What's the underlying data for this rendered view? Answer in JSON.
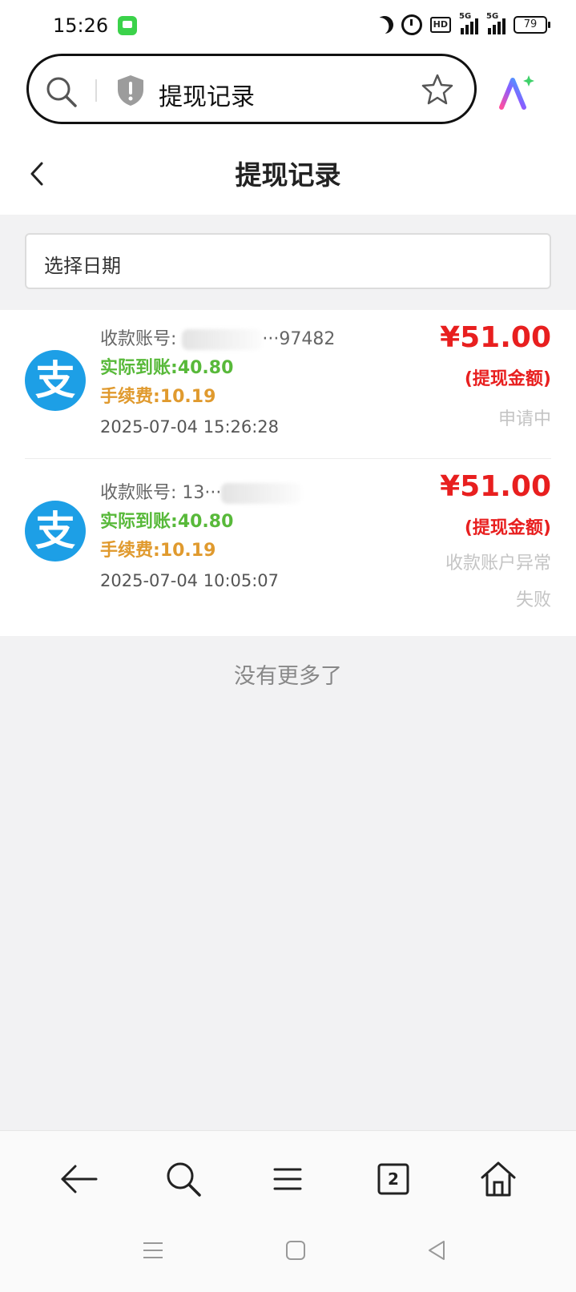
{
  "status_bar": {
    "time": "15:26",
    "hd_label": "HD",
    "sig1_label": "5G",
    "sig2_label": "5G",
    "battery": "79"
  },
  "browser": {
    "url_text": "提现记录"
  },
  "page": {
    "title": "提现记录",
    "date_placeholder": "选择日期",
    "no_more": "没有更多了"
  },
  "records": [
    {
      "account_label": "收款账号:",
      "account_value": "···97482",
      "actual_label": "实际到账:",
      "actual_value": "40.80",
      "fee_label": "手续费:",
      "fee_value": "10.19",
      "datetime": "2025-07-04 15:26:28",
      "amount": "¥51.00",
      "amount_label": "(提现金额)",
      "status": "申请中"
    },
    {
      "account_label": "收款账号:",
      "account_value": "13···",
      "actual_label": "实际到账:",
      "actual_value": "40.80",
      "fee_label": "手续费:",
      "fee_value": "10.19",
      "datetime": "2025-07-04 10:05:07",
      "amount": "¥51.00",
      "amount_label": "(提现金额)",
      "status": "收款账户异常",
      "status2": "失败"
    }
  ],
  "toolbar": {
    "tab_count": "2"
  },
  "avatar_glyph": "支",
  "colors": {
    "accent_red": "#e81f1f",
    "green": "#58b93a",
    "orange": "#e09a2e",
    "alipay_blue": "#1d9fe6"
  }
}
